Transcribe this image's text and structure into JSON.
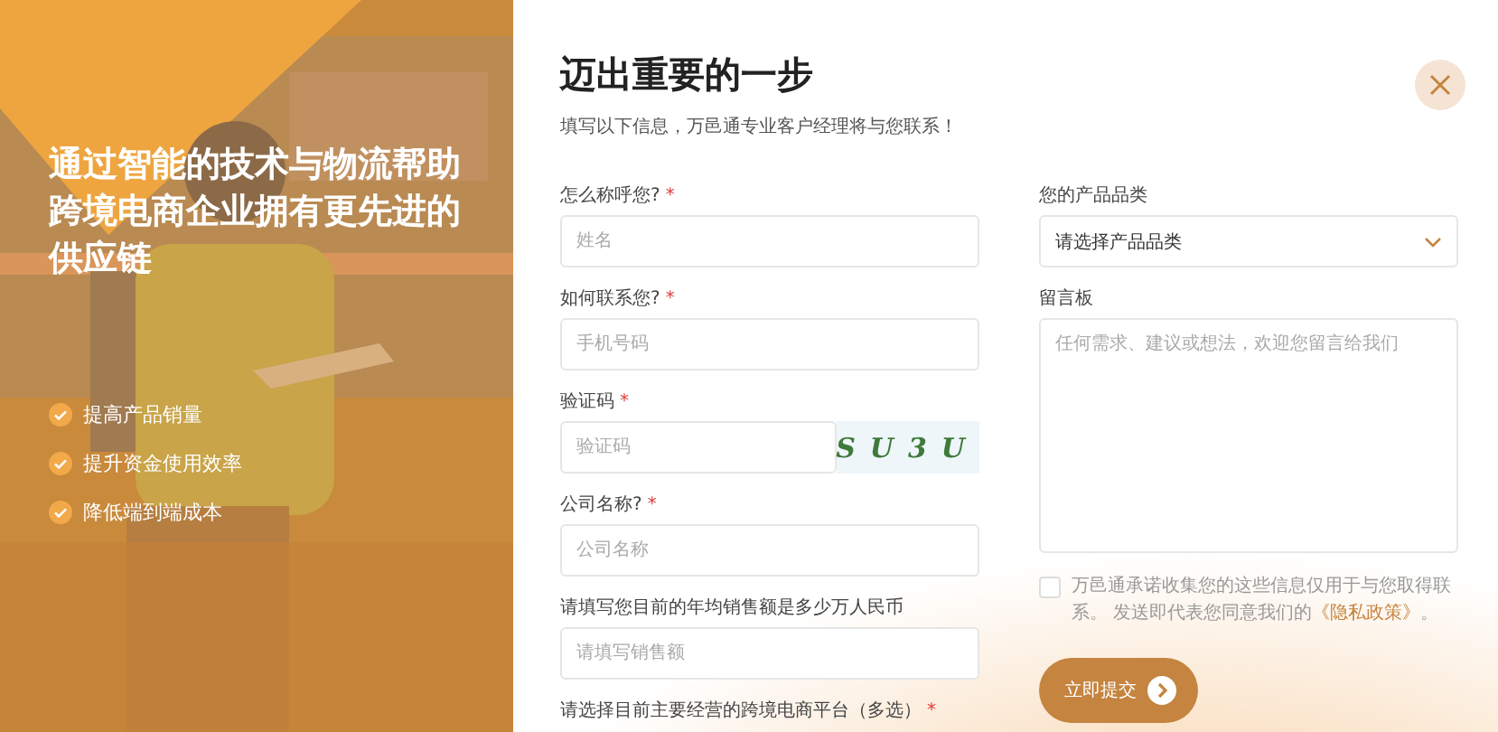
{
  "promo": {
    "headline": "通过智能的技术与物流帮助跨境电商企业拥有更先进的供应链",
    "benefits": [
      "提高产品销量",
      "提升资金使用效率",
      "降低端到端成本"
    ]
  },
  "form": {
    "title": "迈出重要的一步",
    "subtitle": "填写以下信息，万邑通专业客户经理将与您联系！",
    "left_fields": [
      {
        "kind": "input",
        "label": "怎么称呼您?",
        "required_mark": "*",
        "placeholder": "姓名"
      },
      {
        "kind": "input",
        "label": "如何联系您?",
        "required_mark": "*",
        "placeholder": "手机号码"
      },
      {
        "kind": "captcha",
        "label": "验证码",
        "required_mark": "*",
        "placeholder": "验证码",
        "captcha": "SU3U"
      },
      {
        "kind": "input",
        "label": "公司名称?",
        "required_mark": "*",
        "placeholder": "公司名称"
      },
      {
        "kind": "input",
        "label": "请填写您目前的年均销售额是多少万人民币",
        "placeholder": "请填写销售额"
      },
      {
        "kind": "label",
        "label": "请选择目前主要经营的跨境电商平台（多选）",
        "required_mark": "*"
      }
    ],
    "right_fields": [
      {
        "kind": "select",
        "label": "您的产品品类",
        "value": "请选择产品品类"
      },
      {
        "kind": "textarea",
        "label": "留言板",
        "placeholder": "任何需求、建议或想法，欢迎您留言给我们"
      }
    ],
    "consent": {
      "checked": false,
      "text": "万邑通承诺收集您的这些信息仅用于与您取得联系。 发送即代表您同意我们的",
      "link": "《隐私政策》",
      "end": "。"
    },
    "submit": "立即提交"
  }
}
